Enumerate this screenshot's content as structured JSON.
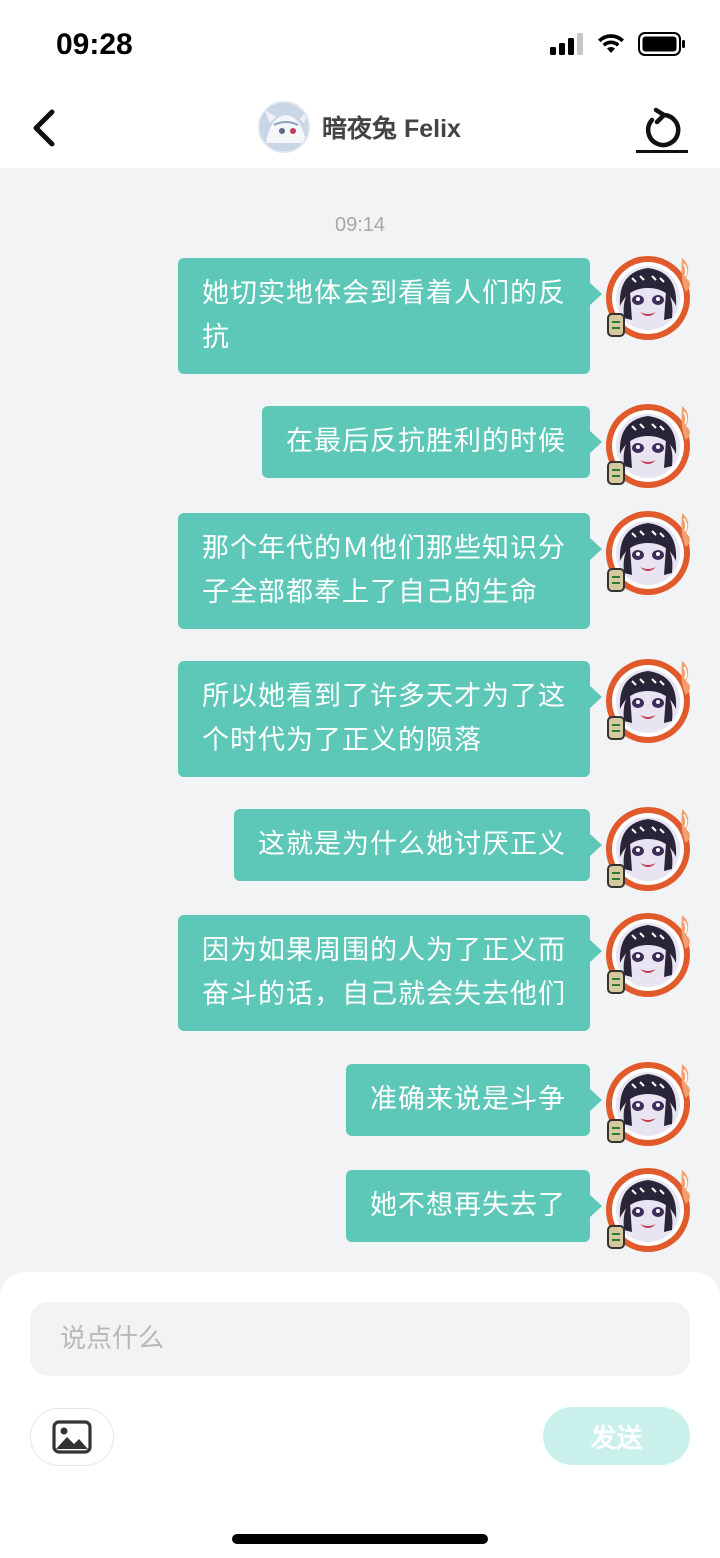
{
  "status_bar": {
    "time": "09:28"
  },
  "nav": {
    "title": "暗夜兔 Felix",
    "back_icon": "chevron-left-icon",
    "refresh_icon": "refresh-icon"
  },
  "chat": {
    "timestamp": "09:14",
    "messages": [
      {
        "text": "她切实地体会到看着人们的反\n抗"
      },
      {
        "text": "在最后反抗胜利的时候"
      },
      {
        "text": "那个年代的Ｍ他们那些知识分\n子全部都奉上了自己的生命"
      },
      {
        "text": "所以她看到了许多天才为了这\n个时代为了正义的陨落"
      },
      {
        "text": "这就是为什么她讨厌正义"
      },
      {
        "text": "因为如果周围的人为了正义而\n奋斗的话，自己就会失去他们"
      },
      {
        "text": "准确来说是斗争"
      },
      {
        "text": "她不想再失去了"
      }
    ]
  },
  "composer": {
    "placeholder": "说点什么",
    "value": "",
    "send_label": "发送",
    "image_icon": "image-icon"
  },
  "colors": {
    "bubble": "#5ec8b8",
    "send_disabled": "#c9f0ea",
    "background": "#f2f3f5"
  }
}
